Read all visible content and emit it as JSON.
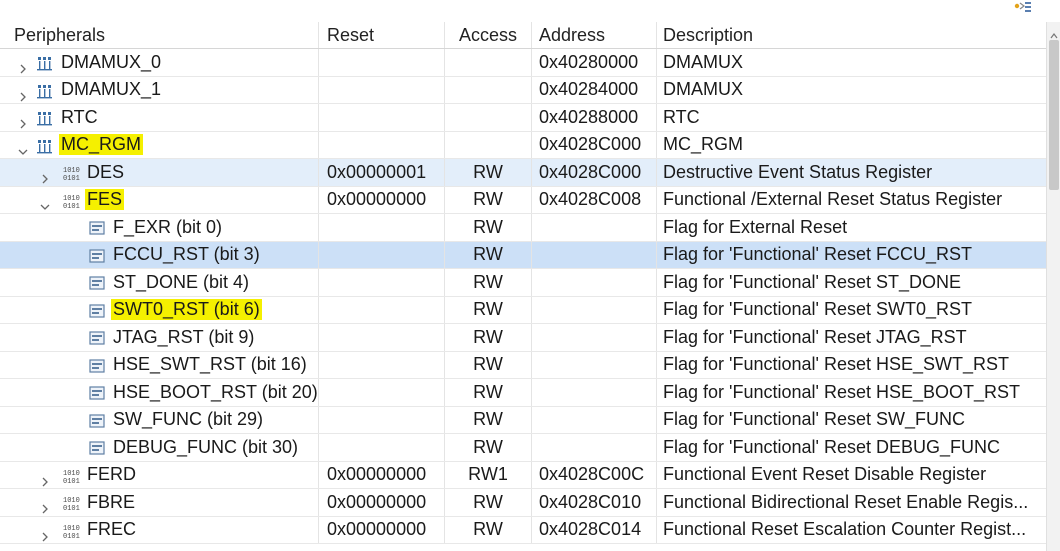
{
  "columns": {
    "peripherals": "Peripherals",
    "reset": "Reset",
    "access": "Access",
    "address": "Address",
    "description": "Description"
  },
  "rows": [
    {
      "label": "DMAMUX_0",
      "reset": "",
      "access": "",
      "address": "0x40280000",
      "description": "DMAMUX",
      "kind": "peripheral",
      "level": 0,
      "expander": "collapsed",
      "highlight": false,
      "selection": "none"
    },
    {
      "label": "DMAMUX_1",
      "reset": "",
      "access": "",
      "address": "0x40284000",
      "description": "DMAMUX",
      "kind": "peripheral",
      "level": 0,
      "expander": "collapsed",
      "highlight": false,
      "selection": "none"
    },
    {
      "label": "RTC",
      "reset": "",
      "access": "",
      "address": "0x40288000",
      "description": "RTC",
      "kind": "peripheral",
      "level": 0,
      "expander": "collapsed",
      "highlight": false,
      "selection": "none"
    },
    {
      "label": "MC_RGM",
      "reset": "",
      "access": "",
      "address": "0x4028C000",
      "description": "MC_RGM",
      "kind": "peripheral",
      "level": 0,
      "expander": "expanded",
      "highlight": true,
      "selection": "none"
    },
    {
      "label": "DES",
      "reset": "0x00000001",
      "access": "RW",
      "address": "0x4028C000",
      "description": "Destructive Event Status Register",
      "kind": "register",
      "level": 1,
      "expander": "collapsed",
      "highlight": false,
      "selection": "light"
    },
    {
      "label": "FES",
      "reset": "0x00000000",
      "access": "RW",
      "address": "0x4028C008",
      "description": "Functional /External Reset Status Register",
      "kind": "register",
      "level": 1,
      "expander": "expanded",
      "highlight": true,
      "selection": "none"
    },
    {
      "label": "F_EXR (bit 0)",
      "reset": "",
      "access": "RW",
      "address": "",
      "description": "Flag for External Reset",
      "kind": "field",
      "level": 2,
      "expander": "none",
      "highlight": false,
      "selection": "none"
    },
    {
      "label": "FCCU_RST (bit 3)",
      "reset": "",
      "access": "RW",
      "address": "",
      "description": "Flag for 'Functional' Reset FCCU_RST",
      "kind": "field",
      "level": 2,
      "expander": "none",
      "highlight": false,
      "selection": "blue"
    },
    {
      "label": "ST_DONE (bit 4)",
      "reset": "",
      "access": "RW",
      "address": "",
      "description": "Flag for 'Functional' Reset ST_DONE",
      "kind": "field",
      "level": 2,
      "expander": "none",
      "highlight": false,
      "selection": "none"
    },
    {
      "label": "SWT0_RST (bit 6)",
      "reset": "",
      "access": "RW",
      "address": "",
      "description": "Flag for 'Functional' Reset SWT0_RST",
      "kind": "field",
      "level": 2,
      "expander": "none",
      "highlight": true,
      "selection": "none"
    },
    {
      "label": "JTAG_RST (bit 9)",
      "reset": "",
      "access": "RW",
      "address": "",
      "description": "Flag for 'Functional' Reset JTAG_RST",
      "kind": "field",
      "level": 2,
      "expander": "none",
      "highlight": false,
      "selection": "none"
    },
    {
      "label": "HSE_SWT_RST (bit 16)",
      "reset": "",
      "access": "RW",
      "address": "",
      "description": "Flag for 'Functional' Reset HSE_SWT_RST",
      "kind": "field",
      "level": 2,
      "expander": "none",
      "highlight": false,
      "selection": "none"
    },
    {
      "label": "HSE_BOOT_RST (bit 20)",
      "reset": "",
      "access": "RW",
      "address": "",
      "description": "Flag for 'Functional' Reset HSE_BOOT_RST",
      "kind": "field",
      "level": 2,
      "expander": "none",
      "highlight": false,
      "selection": "none"
    },
    {
      "label": "SW_FUNC (bit 29)",
      "reset": "",
      "access": "RW",
      "address": "",
      "description": "Flag for 'Functional' Reset SW_FUNC",
      "kind": "field",
      "level": 2,
      "expander": "none",
      "highlight": false,
      "selection": "none"
    },
    {
      "label": "DEBUG_FUNC (bit 30)",
      "reset": "",
      "access": "RW",
      "address": "",
      "description": "Flag for 'Functional' Reset DEBUG_FUNC",
      "kind": "field",
      "level": 2,
      "expander": "none",
      "highlight": false,
      "selection": "none"
    },
    {
      "label": "FERD",
      "reset": "0x00000000",
      "access": "RW1",
      "address": "0x4028C00C",
      "description": "Functional Event Reset Disable Register",
      "kind": "register",
      "level": 1,
      "expander": "collapsed",
      "highlight": false,
      "selection": "none"
    },
    {
      "label": "FBRE",
      "reset": "0x00000000",
      "access": "RW",
      "address": "0x4028C010",
      "description": "Functional Bidirectional Reset Enable Regis...",
      "kind": "register",
      "level": 1,
      "expander": "collapsed",
      "highlight": false,
      "selection": "none"
    },
    {
      "label": "FREC",
      "reset": "0x00000000",
      "access": "RW",
      "address": "0x4028C014",
      "description": "Functional Reset Escalation Counter Regist...",
      "kind": "register",
      "level": 1,
      "expander": "collapsed",
      "highlight": false,
      "selection": "none"
    }
  ],
  "colors": {
    "highlight": "#f5f000",
    "selection_light": "#e3eefa",
    "selection_blue": "#cce0f7",
    "grid_line": "#e8e8e8",
    "icon_blue": "#3a6ea5"
  },
  "icons": {
    "peripheral": "peripheral-icon",
    "register": "register-icon",
    "field": "bitfield-icon",
    "toolbar": "view-menu-icon"
  }
}
